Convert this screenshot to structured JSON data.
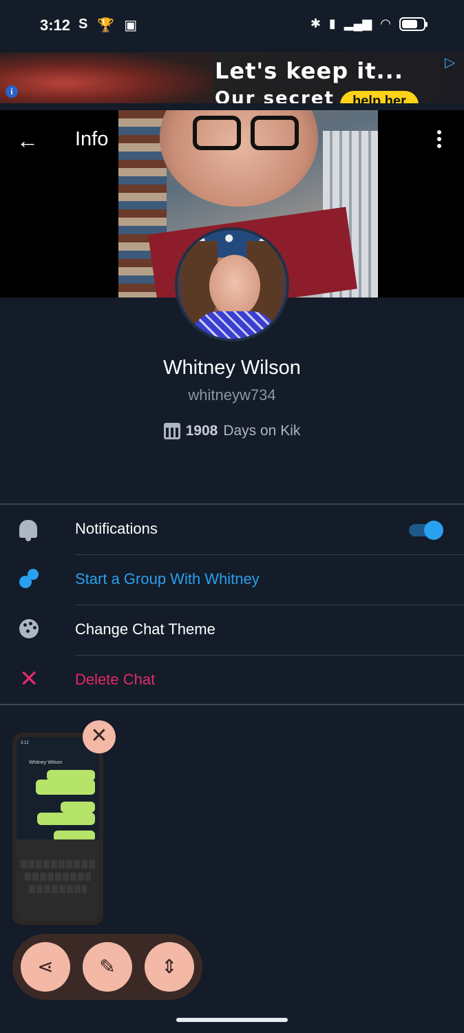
{
  "status_bar": {
    "time": "3:12",
    "left_icons": [
      "S",
      "trophy-icon",
      "twitch-icon"
    ],
    "right_icons": [
      "bluetooth-icon",
      "vibrate-icon",
      "signal-icon",
      "wifi-icon",
      "battery-icon"
    ]
  },
  "ad": {
    "headline": "Let's keep it...",
    "subline": "Our secret",
    "cta": "help her"
  },
  "header": {
    "title": "Info"
  },
  "profile": {
    "name": "Whitney Wilson",
    "username": "whitneyw734",
    "days_count": "1908",
    "days_suffix": "Days on Kik"
  },
  "menu": {
    "notifications": {
      "label": "Notifications",
      "enabled": true
    },
    "start_group": {
      "label": "Start a Group With Whitney",
      "color": "#2aa0f0"
    },
    "change_theme": {
      "label": "Change Chat Theme"
    },
    "delete_chat": {
      "label": "Delete Chat",
      "color": "#e32a6b"
    }
  },
  "screenshot_preview": {
    "chat_title": "Whitney Wilson"
  },
  "colors": {
    "background": "#131c28",
    "accent": "#2aa0f0",
    "danger": "#e32a6b",
    "action_button": "#f3b8a6"
  }
}
